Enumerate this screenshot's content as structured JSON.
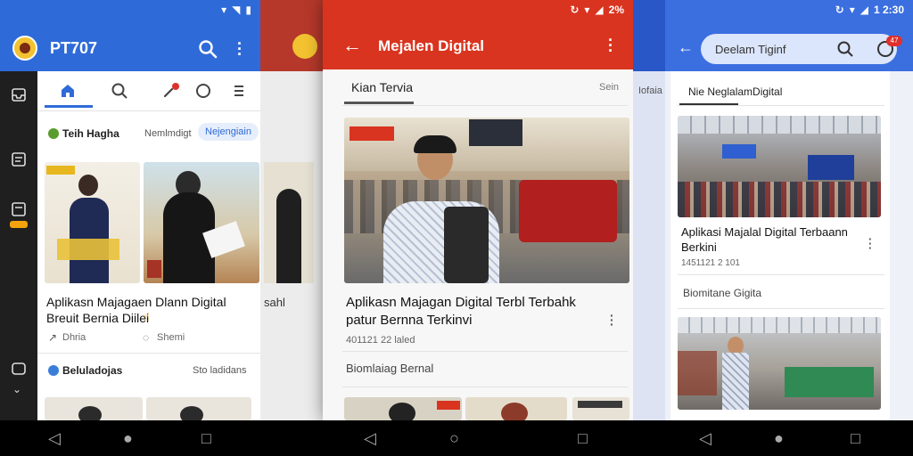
{
  "left": {
    "status_time": "",
    "app_title": "PT707",
    "section_title": "Teih Hagha",
    "filter_label": "Nemlmdigt",
    "filter_chip": "Nejengiain",
    "card_title": "Aplikasn Majagaen Dlann Digital Breuit Bernia Diilei",
    "action_left": "Dhria",
    "action_right": "Shemi",
    "next_section": "Beluladojas",
    "next_section_right": "Sto ladidans",
    "accent": "#2f6bd8"
  },
  "middle": {
    "status_time": "2%",
    "app_title": "Mejalen Digital",
    "tab_label": "Kian Tervia",
    "tab_right": "Sein",
    "card_title": "Aplikasn Majagan Digital Terbl Terbahk patur Bernna Terkinvi",
    "card_meta": "401121 22 laled",
    "next_label": "Biomlaiag Bernal",
    "accent": "#d9341f"
  },
  "right": {
    "search_placeholder": "Deelam Tiginf",
    "badge": "47",
    "tab_label": "Nie NeglalamDigital",
    "card_title": "Aplikasi Majalal Digital Terbaann Berkini",
    "card_meta": "1451121 2 101",
    "next_label": "Biomitane Gigita",
    "accent": "#3b6fe0",
    "status_time": "1 2:30"
  },
  "side_panel": {
    "label_top": "Iofaia Lait",
    "label_bottom": "sahl"
  }
}
